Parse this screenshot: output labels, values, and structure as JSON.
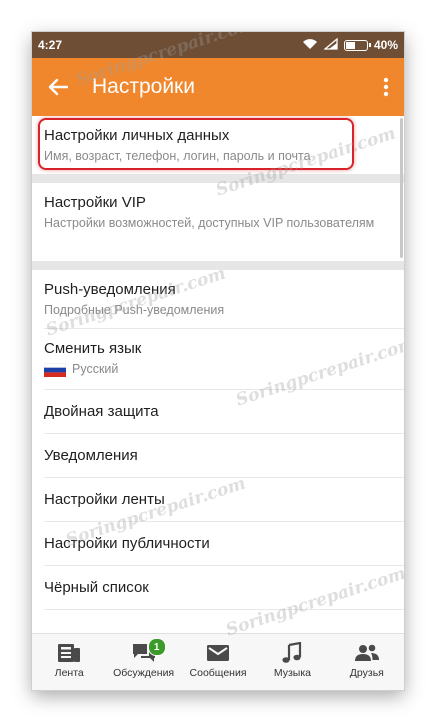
{
  "status_bar": {
    "time": "4:27",
    "battery_percent": "40%",
    "battery_level": 0.4
  },
  "toolbar": {
    "title": "Настройки"
  },
  "settings": {
    "personal": {
      "title": "Настройки личных данных",
      "subtitle": "Имя, возраст, телефон, логин, пароль и почта"
    },
    "vip": {
      "title": "Настройки VIP",
      "subtitle": "Настройки возможностей, доступных VIP пользователям"
    },
    "push": {
      "title": "Push-уведомления",
      "subtitle": "Подробные Push-уведомления"
    },
    "language": {
      "title": "Сменить язык",
      "subtitle": "Русский"
    },
    "two_factor": {
      "title": "Двойная защита"
    },
    "notifications": {
      "title": "Уведомления"
    },
    "feed": {
      "title": "Настройки ленты"
    },
    "publicity": {
      "title": "Настройки публичности"
    },
    "blacklist": {
      "title": "Чёрный список"
    }
  },
  "bottom_nav": {
    "feed": "Лента",
    "discussions": "Обсуждения",
    "discussions_badge": "1",
    "messages": "Сообщения",
    "music": "Музыка",
    "friends": "Друзья"
  },
  "watermark_text": "Soringpcrepair.com",
  "colors": {
    "accent": "#f0872c",
    "status_bar": "#6e4e34",
    "highlight": "#d9232a",
    "badge": "#3a9b2a"
  }
}
